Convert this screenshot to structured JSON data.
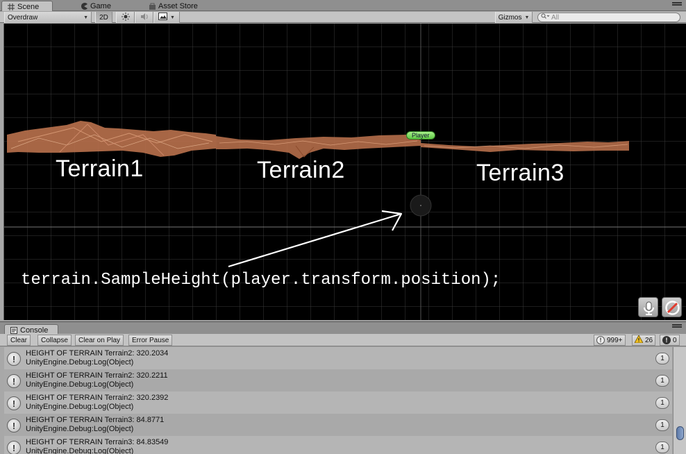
{
  "tabs": {
    "scene": "Scene",
    "game": "Game",
    "asset_store": "Asset Store"
  },
  "toolbar": {
    "render_mode": "Overdraw",
    "mode_2d": "2D",
    "gizmos": "Gizmos",
    "search_placeholder": "All"
  },
  "scene": {
    "terrain_labels": [
      "Terrain1",
      "Terrain2",
      "Terrain3"
    ],
    "player_label": "Player",
    "code_note": "terrain.SampleHeight(player.transform.position);",
    "icons": [
      "microphone-icon",
      "audio-disabled-icon"
    ]
  },
  "console": {
    "tab": "Console",
    "buttons": [
      "Clear",
      "Collapse",
      "Clear on Play",
      "Error Pause"
    ],
    "counts": {
      "info": "999+",
      "warnings": "26",
      "errors": "0"
    },
    "entries": [
      {
        "line1": "HEIGHT OF TERRAIN Terrain2: 320.2034",
        "line2": "UnityEngine.Debug:Log(Object)",
        "count": "1"
      },
      {
        "line1": "HEIGHT OF TERRAIN Terrain2: 320.2211",
        "line2": "UnityEngine.Debug:Log(Object)",
        "count": "1"
      },
      {
        "line1": "HEIGHT OF TERRAIN Terrain2: 320.2392",
        "line2": "UnityEngine.Debug:Log(Object)",
        "count": "1"
      },
      {
        "line1": "HEIGHT OF TERRAIN Terrain3: 84.8771",
        "line2": "UnityEngine.Debug:Log(Object)",
        "count": "1"
      },
      {
        "line1": "HEIGHT OF TERRAIN Terrain3: 84.83549",
        "line2": "UnityEngine.Debug:Log(Object)",
        "count": "1"
      }
    ]
  },
  "colors": {
    "scene_bg": "#000000",
    "terrain": "#b9714c",
    "player_badge": "#6fd24f",
    "grid": "#3a3a3a"
  }
}
